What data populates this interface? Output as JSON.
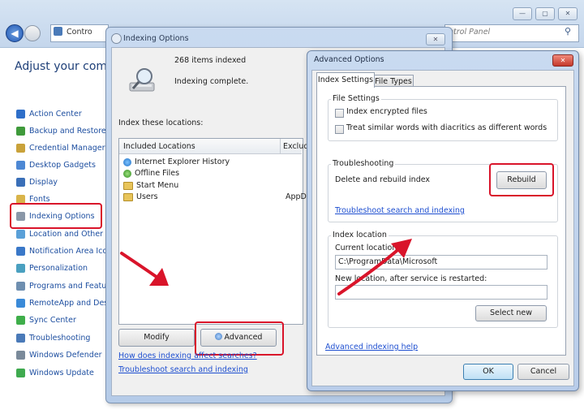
{
  "control_panel": {
    "breadcrumb": "Contro",
    "search_placeholder": "ntrol Panel",
    "title": "Adjust your compu",
    "items": [
      {
        "label": "Action Center",
        "color": "#2f6fc9"
      },
      {
        "label": "Backup and Restore",
        "color": "#3f9a3b"
      },
      {
        "label": "Credential Manager",
        "color": "#c9a23a"
      },
      {
        "label": "Desktop Gadgets",
        "color": "#4d88d4"
      },
      {
        "label": "Display",
        "color": "#3a6fb8"
      },
      {
        "label": "Fonts",
        "color": "#d9b44a"
      },
      {
        "label": "Indexing Options",
        "color": "#8a97a8"
      },
      {
        "label": "Location and Other S",
        "color": "#5aa0d8"
      },
      {
        "label": "Notification Area Ico",
        "color": "#3a78c8"
      },
      {
        "label": "Personalization",
        "color": "#4aa0c0"
      },
      {
        "label": "Programs and Featur",
        "color": "#6f8fb0"
      },
      {
        "label": "RemoteApp and Desk",
        "color": "#3a8ad8"
      },
      {
        "label": "Sync Center",
        "color": "#3fae4a"
      },
      {
        "label": "Troubleshooting",
        "color": "#4a7ab8"
      },
      {
        "label": "Windows Defender",
        "color": "#7a8a9a"
      },
      {
        "label": "Windows Update",
        "color": "#3faa4f"
      }
    ]
  },
  "indexing_options": {
    "title": "Indexing Options",
    "items_indexed": "268 items indexed",
    "status": "Indexing complete.",
    "locations_label": "Index these locations:",
    "columns": {
      "included": "Included Locations",
      "excluded": "Exclud"
    },
    "locations": [
      {
        "name": "Internet Explorer History",
        "icon": "internet-explorer-icon"
      },
      {
        "name": "Offline Files",
        "icon": "offline-files-icon"
      },
      {
        "name": "Start Menu",
        "icon": "folder-icon"
      },
      {
        "name": "Users",
        "icon": "folder-icon",
        "excluded": "AppDa"
      }
    ],
    "modify_label": "Modify",
    "advanced_label": "Advanced",
    "link_how": "How does indexing affect searches?",
    "link_troubleshoot": "Troubleshoot search and indexing"
  },
  "advanced_options": {
    "title": "Advanced Options",
    "tabs": [
      "Index Settings",
      "File Types"
    ],
    "file_settings": {
      "label": "File Settings",
      "encrypt_label": "Index encrypted files",
      "diacritics_label": "Treat similar words with diacritics as different words"
    },
    "troubleshooting": {
      "label": "Troubleshooting",
      "delete_rebuild_label": "Delete and rebuild index",
      "rebuild_label": "Rebuild",
      "link": "Troubleshoot search and indexing"
    },
    "index_location": {
      "label": "Index location",
      "current_label": "Current location:",
      "current_value": "C:\\ProgramData\\Microsoft",
      "new_label": "New location, after service is restarted:",
      "new_value": "",
      "select_new_label": "Select new"
    },
    "advanced_help_link": "Advanced indexing help",
    "ok_label": "OK",
    "cancel_label": "Cancel"
  },
  "annotation_color": "#d9142a"
}
